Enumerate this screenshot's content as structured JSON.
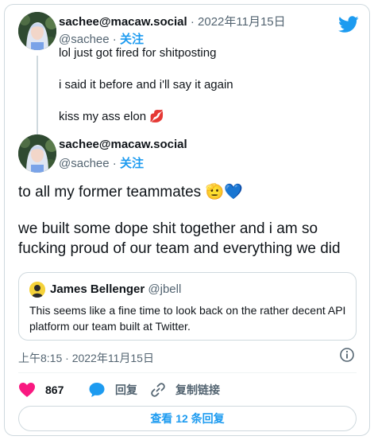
{
  "reply_tweet": {
    "display_name": "sachee@macaw.social",
    "separator": "·",
    "date": "2022年11月15日",
    "handle": "@sachee",
    "dot": "·",
    "follow_label": "关注",
    "lines": [
      "lol just got fired for shitposting",
      "i said it before and i'll say it again",
      "kiss my ass elon 💋"
    ]
  },
  "main_tweet": {
    "display_name": "sachee@macaw.social",
    "handle": "@sachee",
    "dot": "·",
    "follow_label": "关注",
    "lines": [
      "to all my former teammates 🫡💙",
      "we built some dope shit together and i am so",
      "fucking proud of our team and everything we did"
    ],
    "quote": {
      "display_name": "James Bellenger",
      "handle": "@jbell",
      "text": "This seems like a fine time to look back on the rather decent API platform our team built at Twitter."
    },
    "timestamp": "上午8:15 · 2022年11月15日"
  },
  "actions": {
    "like_count": "867",
    "reply_label": "回复",
    "copy_label": "复制链接"
  },
  "more_replies_label": "查看 12 条回复",
  "colors": {
    "accent": "#1d9bf0",
    "like": "#f91880",
    "muted": "#536471",
    "border": "#cfd9de"
  },
  "icons": [
    "twitter-bird-icon",
    "heart-icon",
    "speech-bubble-icon",
    "link-icon",
    "info-icon"
  ]
}
